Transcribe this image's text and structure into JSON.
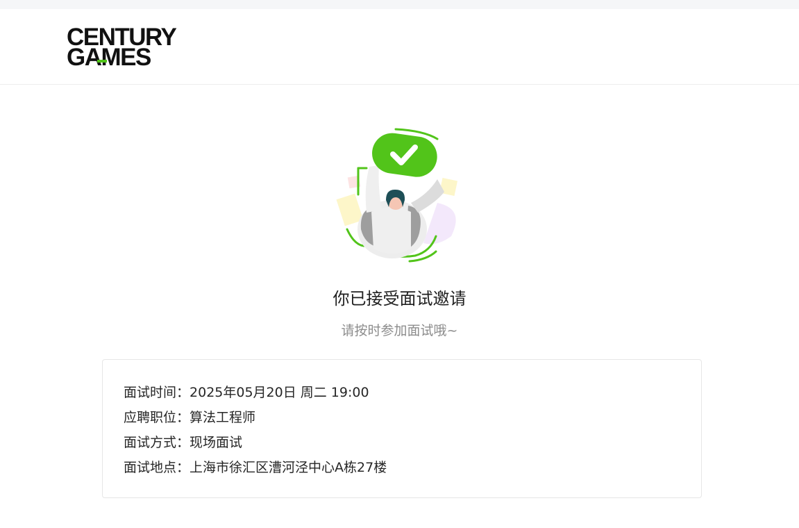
{
  "header": {
    "logo_line1": "CENTURY",
    "logo_line2": "GAMES",
    "accent_color": "#52c41a"
  },
  "illustration": {
    "icon": "check-badge-person-icon",
    "check_color": "#52c41a"
  },
  "status": {
    "title": "你已接受面试邀请",
    "subtitle": "请按时参加面试哦~"
  },
  "details": [
    {
      "label": "面试时间：",
      "value": "2025年05月20日 周二 19:00"
    },
    {
      "label": "应聘职位：",
      "value": "算法工程师"
    },
    {
      "label": "面试方式：",
      "value": "现场面试"
    },
    {
      "label": "面试地点：",
      "value": "上海市徐汇区漕河泾中心A栋27楼"
    }
  ]
}
